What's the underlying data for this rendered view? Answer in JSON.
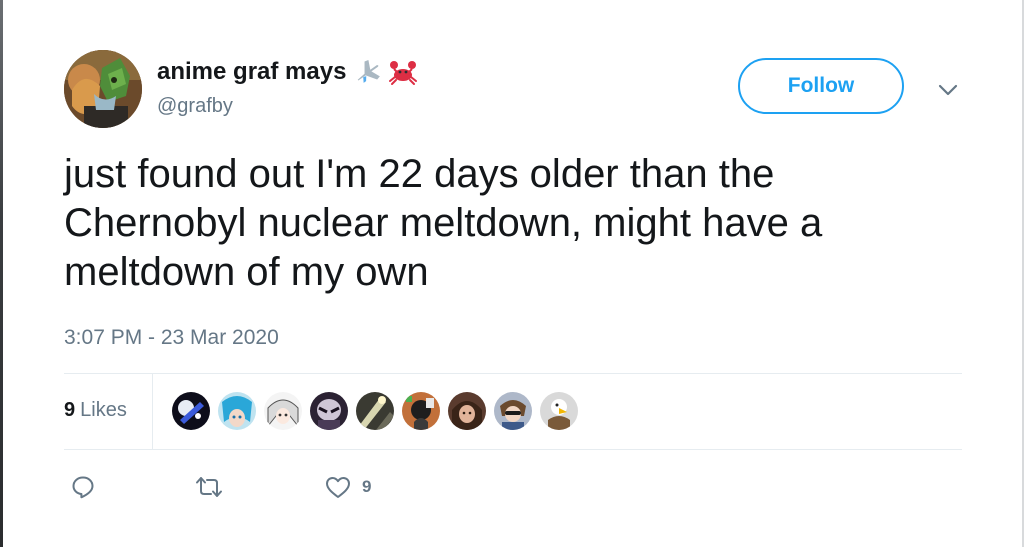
{
  "user": {
    "display_name": "anime graf mays",
    "handle": "@grafby",
    "name_emojis": [
      "airplane-emoji",
      "crab-emoji"
    ]
  },
  "follow_button": {
    "label": "Follow"
  },
  "tweet": {
    "text": "just found out I'm 22 days older than the Chernobyl nuclear meltdown, might have a meltdown of my own",
    "timestamp": "3:07 PM - 23 Mar 2020"
  },
  "likes": {
    "count": "9",
    "label": "Likes",
    "liker_avatars": 9
  },
  "actions": {
    "reply_icon": "reply-icon",
    "retweet_icon": "retweet-icon",
    "like_icon": "heart-icon",
    "like_count": "9"
  },
  "colors": {
    "accent": "#1da1f2",
    "text": "#14171a",
    "muted": "#657786",
    "divider": "#e6ecf0"
  }
}
